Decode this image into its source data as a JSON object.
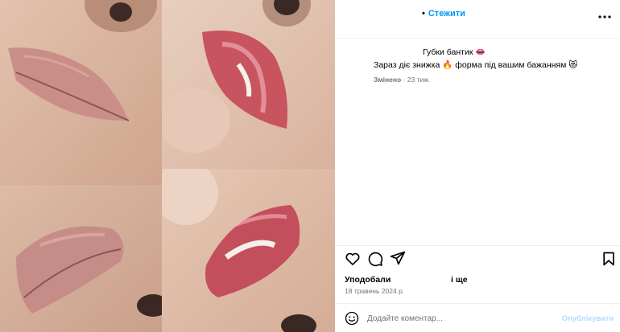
{
  "header": {
    "follow_label": "Стежити",
    "more_icon": "more-horizontal-icon"
  },
  "caption": {
    "line1": "Губки бантик 👄",
    "line2": "Зараз діє знижка 🔥 форма під вашим бажанням 😻",
    "edited": "Змінено",
    "age": "23 тиж."
  },
  "actions": {
    "like_icon": "heart-icon",
    "comment_icon": "comment-icon",
    "share_icon": "share-icon",
    "save_icon": "bookmark-icon"
  },
  "likes": {
    "label": "Уподобали",
    "tail": "і ще"
  },
  "date": "18 травень 2024 р.",
  "comment": {
    "placeholder": "Додайте коментар...",
    "publish_label": "Опублікувати"
  },
  "colors": {
    "accent": "#0095f6",
    "publish_disabled": "#b3dbff",
    "secondary_text": "#737373",
    "divider": "#efefef"
  }
}
